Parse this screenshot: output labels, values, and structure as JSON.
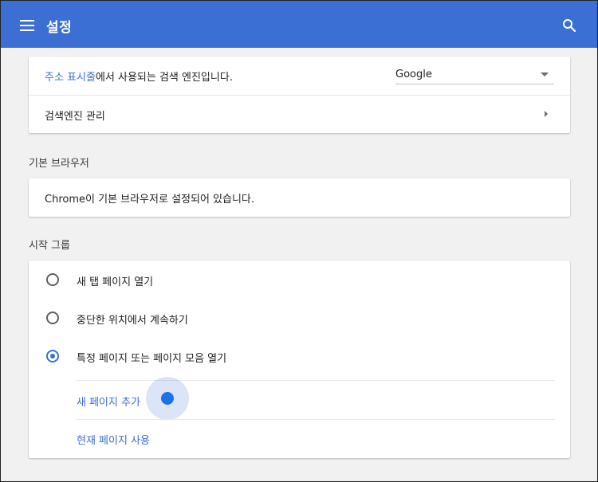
{
  "header": {
    "title": "설정",
    "menu_icon": "menu-icon",
    "search_icon": "search-icon"
  },
  "search_engine": {
    "label_link": "주소 표시줄",
    "label_rest": "에서 사용되는 검색 엔진입니다.",
    "selected": "Google",
    "manage_label": "검색엔진 관리"
  },
  "default_browser": {
    "section_title": "기본 브라우저",
    "status": "Chrome이 기본 브라우저로 설정되어 있습니다."
  },
  "startup": {
    "section_title": "시작 그룹",
    "options": [
      {
        "label": "새 탭 페이지 열기",
        "checked": false
      },
      {
        "label": "중단한 위치에서 계속하기",
        "checked": false
      },
      {
        "label": "특정 페이지 또는 페이지 모음 열기",
        "checked": true
      }
    ],
    "add_page_label": "새 페이지 추가",
    "use_current_label": "현재 페이지 사용"
  },
  "colors": {
    "accent": "#3b6fd4",
    "header_bg": "#3b6fd4",
    "page_bg": "#f1f1f1"
  }
}
